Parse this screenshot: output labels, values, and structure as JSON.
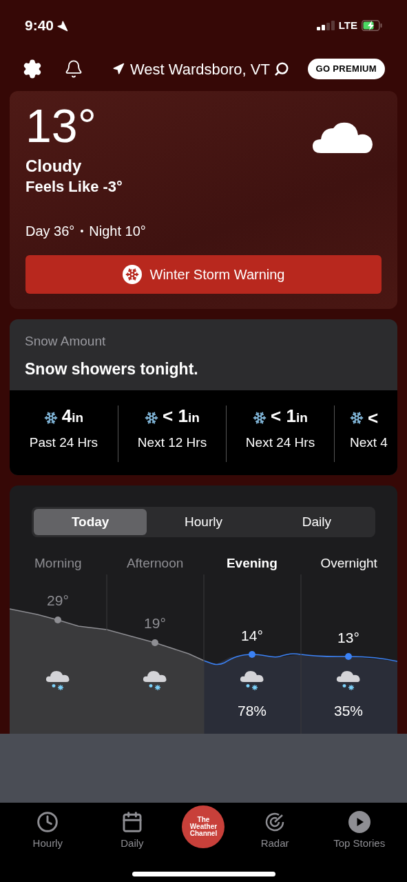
{
  "status_bar": {
    "time": "9:40",
    "network": "LTE"
  },
  "header": {
    "location": "West Wardsboro, VT",
    "premium_button": "GO PREMIUM"
  },
  "current": {
    "temperature": "13°",
    "condition": "Cloudy",
    "feels_like": "Feels Like -3°",
    "day": "Day 36°",
    "separator": "•",
    "night": "Night 10°",
    "alert": "Winter Storm Warning"
  },
  "snow": {
    "label": "Snow Amount",
    "headline": "Snow showers tonight.",
    "items": [
      {
        "amount": "4",
        "unit": "in",
        "period": "Past 24 Hrs"
      },
      {
        "amount": "< 1",
        "unit": "in",
        "period": "Next 12 Hrs"
      },
      {
        "amount": "< 1",
        "unit": "in",
        "period": "Next 24 Hrs"
      },
      {
        "amount": "<",
        "period": "Next 4"
      }
    ]
  },
  "forecast": {
    "tabs": [
      {
        "label": "Today",
        "selected": true
      },
      {
        "label": "Hourly",
        "selected": false
      },
      {
        "label": "Daily",
        "selected": false
      }
    ],
    "periods": [
      {
        "name": "Morning",
        "temp": "29°",
        "past": true,
        "selected": false
      },
      {
        "name": "Afternoon",
        "temp": "19°",
        "past": true,
        "selected": false
      },
      {
        "name": "Evening",
        "temp": "14°",
        "past": false,
        "selected": true,
        "precip": "78%"
      },
      {
        "name": "Overnight",
        "temp": "13°",
        "past": false,
        "selected": false,
        "precip": "35%"
      }
    ]
  },
  "bottom_nav": {
    "items": [
      {
        "kind": "clock",
        "label": "Hourly"
      },
      {
        "kind": "calendar",
        "label": "Daily"
      },
      {
        "kind": "logo",
        "lines": [
          "The",
          "Weather",
          "Channel"
        ]
      },
      {
        "kind": "radar",
        "label": "Radar"
      },
      {
        "kind": "play",
        "label": "Top Stories"
      }
    ]
  }
}
